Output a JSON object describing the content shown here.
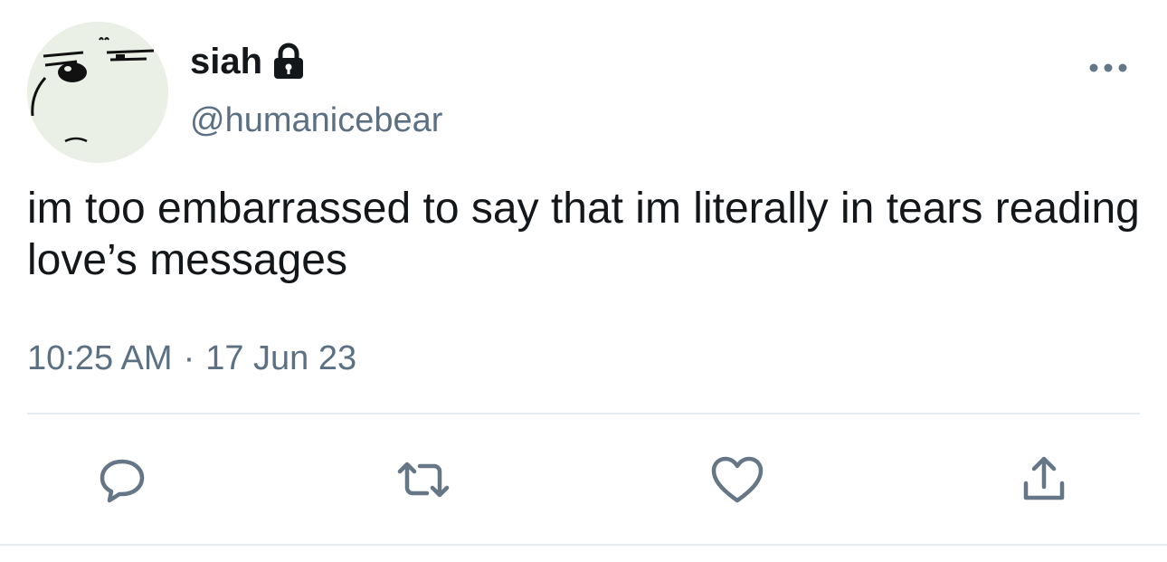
{
  "tweet": {
    "author": {
      "display_name": "siah",
      "handle": "@humanicebear",
      "protected": true,
      "avatar_icon": "ice-bear-face-avatar"
    },
    "text": "im too embarrassed to say that im literally in tears reading love’s messages",
    "time": "10:25 AM",
    "separator": "·",
    "date": "17 Jun 23"
  },
  "actions": [
    {
      "name": "reply",
      "icon": "speech-bubble-icon"
    },
    {
      "name": "retweet",
      "icon": "retweet-arrows-icon"
    },
    {
      "name": "like",
      "icon": "heart-icon"
    },
    {
      "name": "share",
      "icon": "share-upload-icon"
    }
  ],
  "colors": {
    "text": "#14171a",
    "secondary": "#5b7083",
    "action_icon": "#657786",
    "divider": "#e6ecf0",
    "avatar_bg": "#eaf0e6"
  }
}
